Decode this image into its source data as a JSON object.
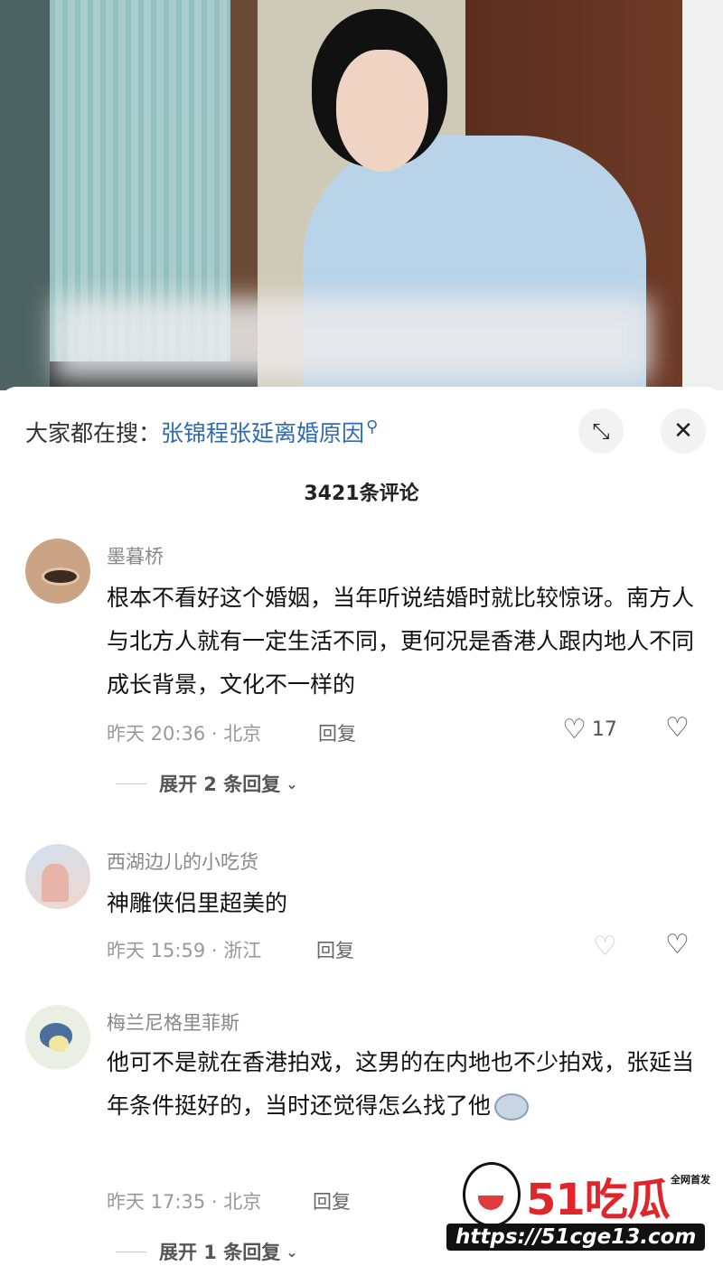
{
  "search": {
    "prefix": "大家都在搜：",
    "term": "张锦程张延离婚原因"
  },
  "comment_count": "3421条评论",
  "comments": [
    {
      "username": "墨暮桥",
      "text": "根本不看好这个婚姻，当年听说结婚时就比较惊讶。南方人与北方人就有一定生活不同，更何况是香港人跟内地人不同成长背景，文化不一样的",
      "meta": "昨天 20:36 · 北京",
      "reply_label": "回复",
      "likes": "17",
      "expand_label": "展开 2 条回复"
    },
    {
      "username": "西湖边儿的小吃货",
      "text": "神雕侠侣里超美的",
      "meta": "昨天 15:59 · 浙江",
      "reply_label": "回复",
      "likes": ""
    },
    {
      "username": "梅兰尼格里菲斯",
      "text": "他可不是就在香港拍戏，这男的在内地也不少拍戏，张延当年条件挺好的，当时还觉得怎么找了他",
      "meta": "昨天 17:35 · 北京",
      "reply_label": "回复",
      "expand_label": "展开 1 条回复"
    }
  ],
  "watermark": {
    "brand": "51吃瓜",
    "tag": "全网首发",
    "url": "https://51cge13.com"
  },
  "icons": {
    "search": "search-icon",
    "expand": "expand-icon",
    "close": "close-icon",
    "like": "heart-icon",
    "dislike": "broken-heart-icon",
    "chevron": "chevron-down-icon"
  }
}
